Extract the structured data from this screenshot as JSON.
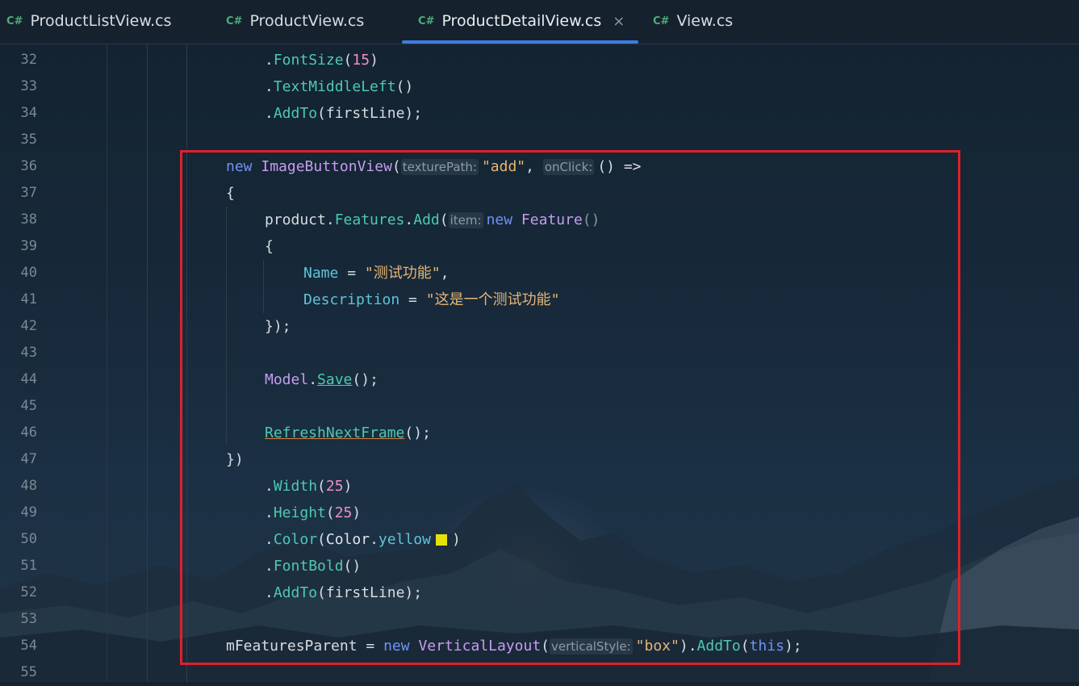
{
  "tabs": [
    {
      "lang": "C#",
      "label": "ProductListView.cs",
      "active": false
    },
    {
      "lang": "C#",
      "label": "ProductView.cs",
      "active": false
    },
    {
      "lang": "C#",
      "label": "ProductDetailView.cs",
      "active": true,
      "close": "×"
    },
    {
      "lang": "C#",
      "label": "View.cs",
      "active": false
    }
  ],
  "line_numbers": [
    "32",
    "33",
    "34",
    "35",
    "36",
    "37",
    "38",
    "39",
    "40",
    "41",
    "42",
    "43",
    "44",
    "45",
    "46",
    "47",
    "48",
    "49",
    "50",
    "51",
    "52",
    "53",
    "54",
    "55"
  ],
  "code": {
    "l32": {
      "dot": ".",
      "method": "FontSize",
      "open": "(",
      "num": "15",
      "close": ")"
    },
    "l33": {
      "dot": ".",
      "method": "TextMiddleLeft",
      "parens": "()"
    },
    "l34": {
      "dot": ".",
      "method": "AddTo",
      "rest": "(firstLine);"
    },
    "l36": {
      "kw": "new",
      "type": "ImageButtonView",
      "open": "(",
      "hint1": "texturePath:",
      "str": "\"add\"",
      "comma": ",",
      "hint2": "onClick:",
      "rest": "() =>"
    },
    "l37": {
      "text": "{"
    },
    "l38": {
      "obj": "product.",
      "prop": "Features",
      "dot": ".",
      "method": "Add",
      "open": "(",
      "hint": "item:",
      "kw": "new",
      "type": "Feature",
      "parens": "()"
    },
    "l39": {
      "text": "{"
    },
    "l40": {
      "prop": "Name",
      "eq": " = ",
      "str": "\"测试功能\"",
      "comma": ","
    },
    "l41": {
      "prop": "Description",
      "eq": " = ",
      "str": "\"这是一个测试功能\""
    },
    "l42": {
      "text": "});"
    },
    "l44": {
      "type": "Model",
      "dot": ".",
      "method": "Save",
      "rest": "();"
    },
    "l46": {
      "method": "RefreshNextFrame",
      "rest": "();"
    },
    "l47": {
      "text": "})"
    },
    "l48": {
      "dot": ".",
      "method": "Width",
      "open": "(",
      "num": "25",
      "close": ")"
    },
    "l49": {
      "dot": ".",
      "method": "Height",
      "open": "(",
      "num": "25",
      "close": ")"
    },
    "l50": {
      "dot": ".",
      "method": "Color",
      "open": "(",
      "type": "Color",
      "dot2": ".",
      "prop": "yellow",
      "close": ")",
      "swatch_color": "#e4e20a"
    },
    "l51": {
      "dot": ".",
      "method": "FontBold",
      "parens": "()"
    },
    "l52": {
      "dot": ".",
      "method": "AddTo",
      "rest": "(firstLine);"
    },
    "l54": {
      "var": "mFeaturesParent",
      "eq": " = ",
      "kw": "new",
      "type": "VerticalLayout",
      "open": "(",
      "hint": "verticalStyle:",
      "str": "\"box\"",
      "close": ")",
      "dot": ".",
      "method": "AddTo",
      "open2": "(",
      "kw2": "this",
      "end": ");"
    }
  },
  "colors": {
    "highlight_box": "#e0202a",
    "active_tab_indicator": "#3d7ce0",
    "keyword": "#6e93f5",
    "type": "#c89cf0",
    "method": "#4ec9b0",
    "string": "#e6b673",
    "number": "#f08fc4"
  }
}
